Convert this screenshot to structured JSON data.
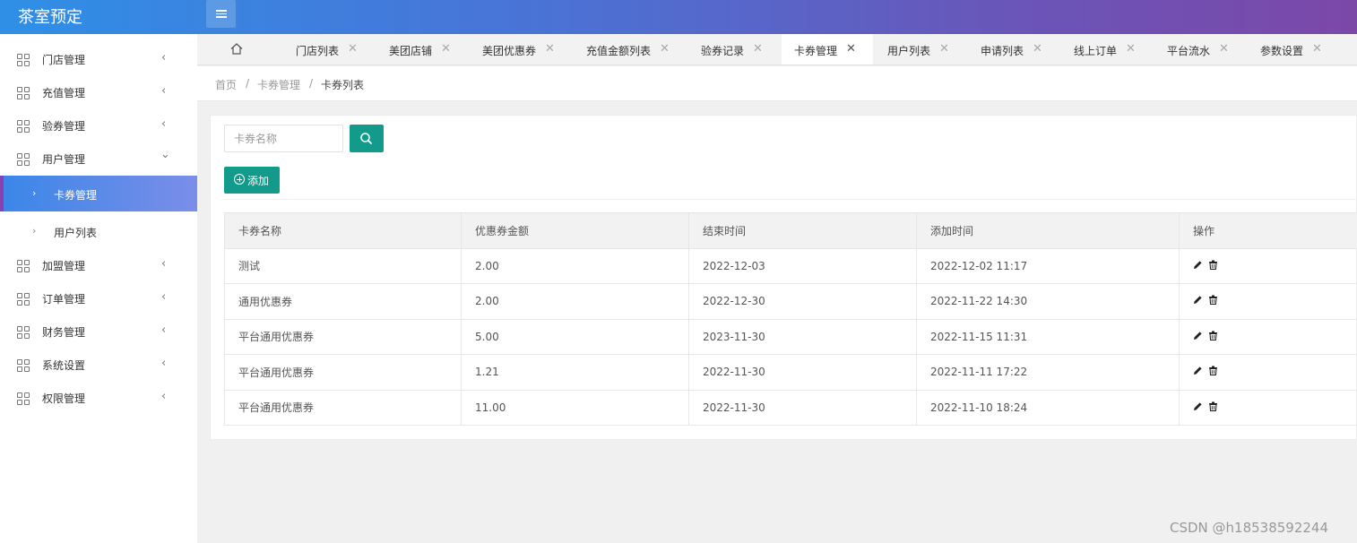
{
  "app": {
    "title": "茶室预定"
  },
  "sidebar": {
    "items": [
      {
        "label": "门店管理",
        "expanded": false
      },
      {
        "label": "充值管理",
        "expanded": false
      },
      {
        "label": "验券管理",
        "expanded": false
      },
      {
        "label": "用户管理",
        "expanded": true,
        "children": [
          {
            "label": "卡券管理",
            "active": true
          },
          {
            "label": "用户列表",
            "active": false
          }
        ]
      },
      {
        "label": "加盟管理",
        "expanded": false
      },
      {
        "label": "订单管理",
        "expanded": false
      },
      {
        "label": "财务管理",
        "expanded": false
      },
      {
        "label": "系统设置",
        "expanded": false
      },
      {
        "label": "权限管理",
        "expanded": false
      }
    ]
  },
  "tabs": [
    {
      "label": "门店列表"
    },
    {
      "label": "美团店铺"
    },
    {
      "label": "美团优惠券"
    },
    {
      "label": "充值金额列表"
    },
    {
      "label": "验券记录"
    },
    {
      "label": "卡券管理",
      "active": true
    },
    {
      "label": "用户列表"
    },
    {
      "label": "申请列表"
    },
    {
      "label": "线上订单"
    },
    {
      "label": "平台流水"
    },
    {
      "label": "参数设置"
    }
  ],
  "breadcrumb": {
    "home": "首页",
    "sep": "/",
    "parent": "卡券管理",
    "current": "卡券列表"
  },
  "toolbar": {
    "search_placeholder": "卡券名称",
    "add_label": "添加"
  },
  "table": {
    "headers": [
      "卡券名称",
      "优惠券金额",
      "结束时间",
      "添加时间",
      "操作"
    ],
    "rows": [
      [
        "测试",
        "2.00",
        "2022-12-03",
        "2022-12-02 11:17"
      ],
      [
        "通用优惠券",
        "2.00",
        "2022-12-30",
        "2022-11-22 14:30"
      ],
      [
        "平台通用优惠券",
        "5.00",
        "2023-11-30",
        "2022-11-15 11:31"
      ],
      [
        "平台通用优惠券",
        "1.21",
        "2022-11-30",
        "2022-11-11 17:22"
      ],
      [
        "平台通用优惠券",
        "11.00",
        "2022-11-30",
        "2022-11-10 18:24"
      ]
    ]
  },
  "watermark": "CSDN @h18538592244",
  "colors": {
    "accent": "#129a8a",
    "header_start": "#2f8fe6",
    "header_end": "#7b48a8",
    "sidebar_active": "#3a86e8"
  }
}
